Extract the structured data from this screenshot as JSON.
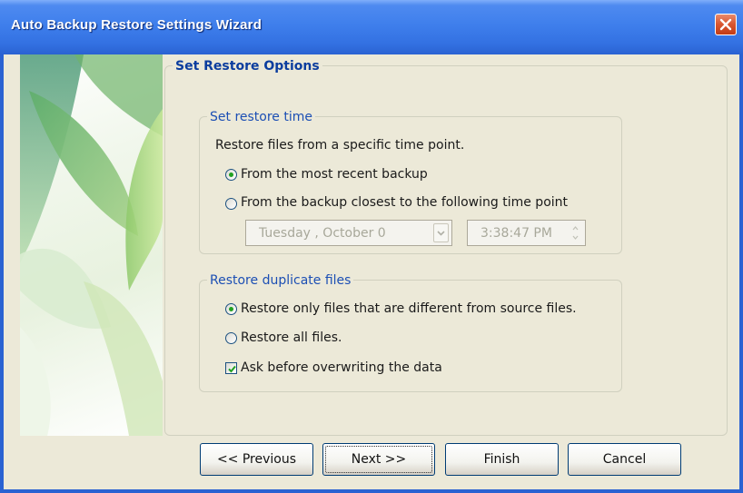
{
  "window": {
    "title": "Auto Backup Restore Settings Wizard"
  },
  "main_group": {
    "title": "Set Restore Options"
  },
  "restore_time": {
    "title": "Set restore time",
    "description": "Restore files from a specific time point.",
    "options": [
      {
        "label": "From the most recent backup",
        "checked": true
      },
      {
        "label": "From the backup closest to the following time point",
        "checked": false
      }
    ],
    "date_value": "Tuesday  ,  October  0",
    "time_value": "3:38:47 PM",
    "pickers_enabled": false
  },
  "duplicate": {
    "title": "Restore duplicate files",
    "options": [
      {
        "label": "Restore only files that are different from source files.",
        "checked": true
      },
      {
        "label": "Restore all files.",
        "checked": false
      }
    ],
    "ask_checkbox": {
      "label": "Ask before overwriting the data",
      "checked": true
    }
  },
  "buttons": {
    "previous": "<< Previous",
    "next": "Next >>",
    "finish": "Finish",
    "cancel": "Cancel"
  },
  "colors": {
    "titlebar": "#3371e2",
    "window_bg": "#ece9d8",
    "group_title": "#1c4fb4",
    "radio_dot": "#21a121"
  },
  "icons": [
    "close-icon",
    "dropdown-arrow-icon",
    "spin-up-icon",
    "spin-down-icon",
    "checkmark-icon"
  ]
}
